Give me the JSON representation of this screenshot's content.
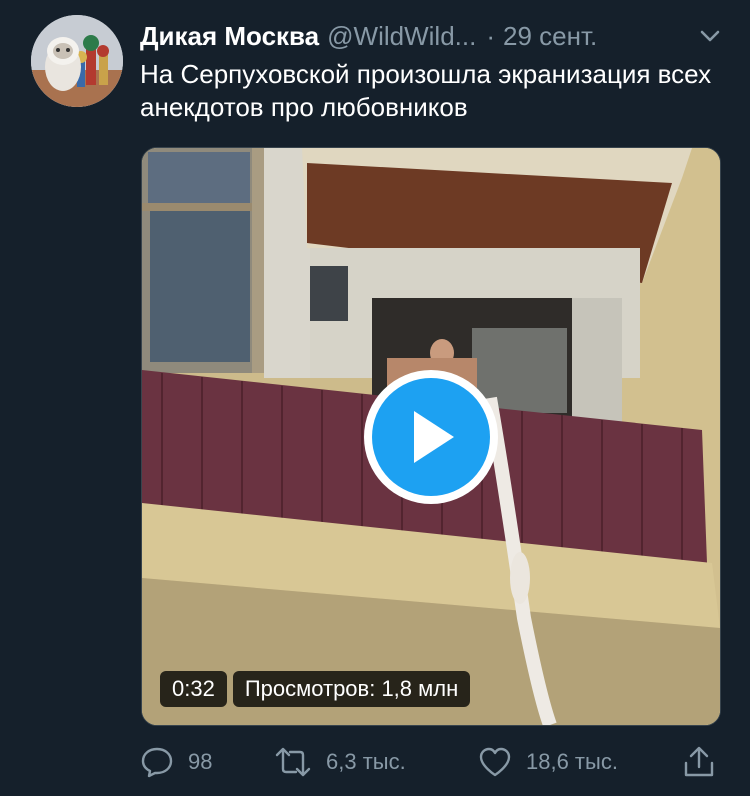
{
  "tweet": {
    "author_name": "Дикая Москва",
    "handle": "@WildWild...",
    "separator": "·",
    "time": "29 сент.",
    "text": "На Серпуховской произошла экранизация всех анекдотов про любовников"
  },
  "video": {
    "duration": "0:32",
    "views": "Просмотров: 1,8 млн"
  },
  "actions": {
    "replies": "98",
    "retweets": "6,3 тыс.",
    "likes": "18,6 тыс."
  },
  "colors": {
    "background": "#15202b",
    "secondary_text": "#8899a6",
    "accent": "#1da1f2"
  },
  "icons": [
    "caret-down-icon",
    "play-icon",
    "reply-icon",
    "retweet-icon",
    "like-icon",
    "share-icon"
  ]
}
